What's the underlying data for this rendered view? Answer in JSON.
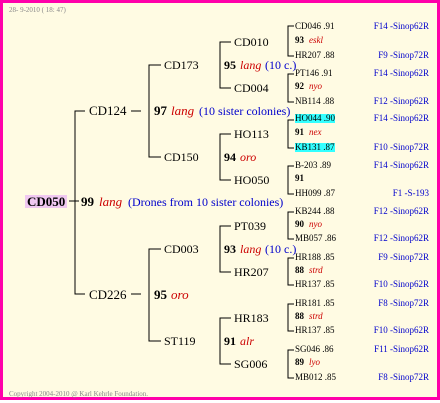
{
  "header": {
    "date": "28- 9-2010 ( 18: 47)"
  },
  "footer": {
    "copyright": "Copyright 2004-2010 @ Karl Kehrle Foundation."
  },
  "root": {
    "name": "CD050",
    "score": "99",
    "breed": "lang",
    "note": "(Drones from 10 sister colonies)"
  },
  "gen1": [
    {
      "name": "CD124",
      "score": "97",
      "breed": "lang",
      "note": "(10 sister colonies)"
    },
    {
      "name": "CD226",
      "score": "95",
      "breed": "oro",
      "note": ""
    }
  ],
  "gen2": [
    {
      "name": "CD173",
      "score": "95",
      "breed": "lang",
      "note": "(10 c.)"
    },
    {
      "name": "CD150",
      "score": "94",
      "breed": "oro",
      "note": ""
    },
    {
      "name": "CD003",
      "score": "93",
      "breed": "lang",
      "note": "(10 c.)"
    },
    {
      "name": "ST119",
      "score": "91",
      "breed": "alr",
      "note": ""
    }
  ],
  "gen3": [
    {
      "name": "CD010",
      "score": "93",
      "breed": "eskl"
    },
    {
      "name": "CD004",
      "score": "92",
      "breed": "nyo"
    },
    {
      "name": "HO113",
      "score": "91",
      "breed": "nex"
    },
    {
      "name": "HO050",
      "score": "91",
      "breed": ""
    },
    {
      "name": "PT039",
      "score": "90",
      "breed": "nyo"
    },
    {
      "name": "HR207",
      "score": "88",
      "breed": "strd"
    },
    {
      "name": "HR183",
      "score": "88",
      "breed": "strd"
    },
    {
      "name": "SG006",
      "score": "89",
      "breed": "lyo"
    }
  ],
  "gen4": [
    {
      "name": "CD046 .91",
      "origin": "F14 -Sinop62R"
    },
    {
      "name": "HR207 .88",
      "origin": "F9 -Sinop72R"
    },
    {
      "name": "PT146 .91",
      "origin": "F14 -Sinop62R"
    },
    {
      "name": "NB114 .88",
      "origin": "F12 -Sinop62R"
    },
    {
      "name": "HO044 .90",
      "origin": "F14 -Sinop62R"
    },
    {
      "name": "KB131 .87",
      "origin": "F10 -Sinop72R"
    },
    {
      "name": "B-203 .89",
      "origin": "F14 -Sinop62R"
    },
    {
      "name": "HH099 .87",
      "origin": "F1 -S-193"
    },
    {
      "name": "KB244 .88",
      "origin": "F12 -Sinop62R"
    },
    {
      "name": "MB057 .86",
      "origin": "F12 -Sinop62R"
    },
    {
      "name": "HR188 .85",
      "origin": "F9 -Sinop72R"
    },
    {
      "name": "HR137 .85",
      "origin": "F10 -Sinop62R"
    },
    {
      "name": "HR181 .85",
      "origin": "F8 -Sinop72R"
    },
    {
      "name": "HR137 .85",
      "origin": "F10 -Sinop62R"
    },
    {
      "name": "SG046 .86",
      "origin": "F11 -Sinop62R"
    },
    {
      "name": "MB012 .85",
      "origin": "F8 -Sinop72R"
    }
  ]
}
